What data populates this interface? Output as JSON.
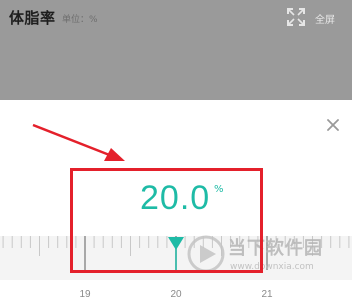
{
  "header": {
    "title": "体脂率",
    "unit_label": "单位：%",
    "fullscreen_label": "全屏",
    "fullscreen_icon": "fullscreen-icon"
  },
  "dialog": {
    "close_icon": "close-icon",
    "value": "20.0",
    "unit": "%",
    "accent_color": "#1ebba6"
  },
  "ruler": {
    "labels": [
      "19",
      "20",
      "21"
    ],
    "selected_value": 20.0,
    "pointer_icon": "triangle-pointer-icon"
  },
  "watermark": {
    "text": "当下软件园",
    "url": "www.downxia.com"
  },
  "annotation": {
    "highlight_color": "#e4202b"
  }
}
